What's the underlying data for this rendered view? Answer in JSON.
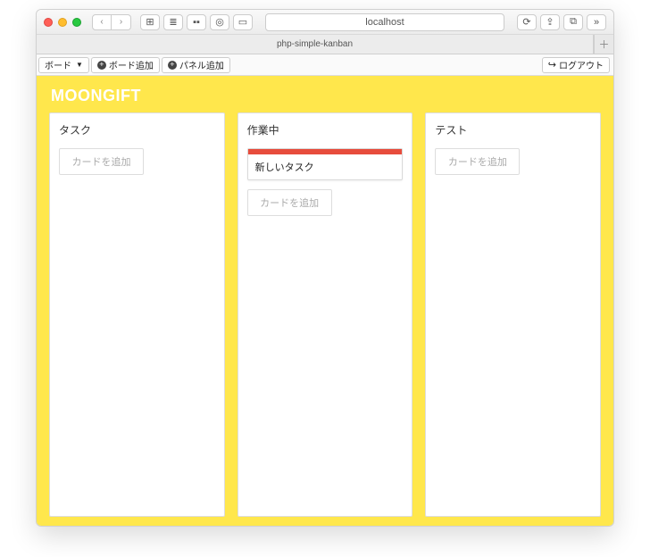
{
  "browser": {
    "address": "localhost",
    "tab_title": "php-simple-kanban"
  },
  "toolbar": {
    "board_menu": "ボード",
    "board_add": "ボード追加",
    "panel_add": "パネル追加",
    "logout": "ログアウト"
  },
  "board": {
    "title": "MOONGIFT",
    "columns": [
      {
        "title": "タスク",
        "cards": [],
        "add_label": "カードを追加"
      },
      {
        "title": "作業中",
        "cards": [
          {
            "label_color": "red",
            "text": "新しいタスク"
          }
        ],
        "add_label": "カードを追加"
      },
      {
        "title": "テスト",
        "cards": [],
        "add_label": "カードを追加"
      }
    ]
  }
}
